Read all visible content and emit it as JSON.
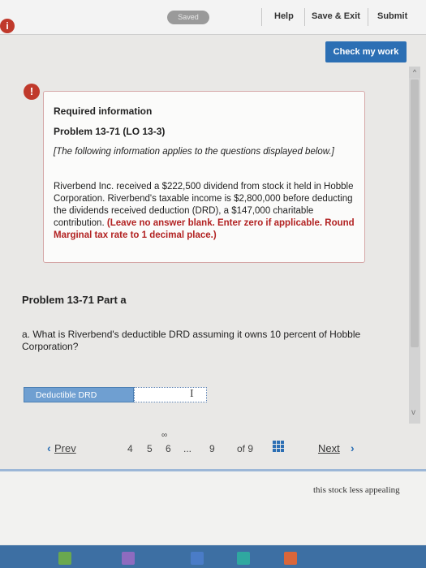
{
  "topbar": {
    "saved_label": "Saved",
    "help": "Help",
    "save_exit": "Save & Exit",
    "submit": "Submit"
  },
  "check_label": "Check my work",
  "info": {
    "title": "Required information",
    "problem": "Problem 13-71 (LO 13-3)",
    "note": "[The following information applies to the questions displayed below.]",
    "body": "Riverbend Inc. received a $222,500 dividend from stock it held in Hobble Corporation. Riverbend's taxable income is $2,800,000 before deducting the dividends received deduction (DRD), a $147,000 charitable contribution.",
    "instructions": "(Leave no answer blank. Enter zero if applicable. Round Marginal tax rate to 1 decimal place.)"
  },
  "part": {
    "title": "Problem 13-71 Part a",
    "question": "a. What is Riverbend's deductible DRD assuming it owns 10 percent of Hobble Corporation?",
    "input_label": "Deductible DRD",
    "input_value": ""
  },
  "nav": {
    "prev": "Prev",
    "pages": [
      "4",
      "5",
      "6",
      "...",
      "9"
    ],
    "of": "of 9",
    "next": "Next"
  },
  "background_text": "this stock less appealing",
  "colors": {
    "accent": "#2c6fb4",
    "alert": "#c0392b",
    "label_blue": "#6f9fd1"
  }
}
